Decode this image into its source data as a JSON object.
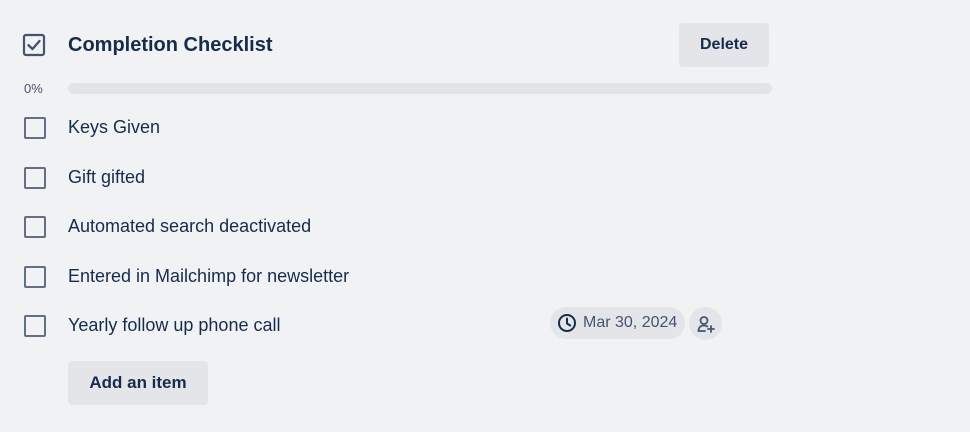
{
  "checklist": {
    "title": "Completion Checklist",
    "header_icon": "checkbox-checked-icon",
    "delete_label": "Delete",
    "progress_text": "0%",
    "progress_fraction": 0,
    "items": [
      {
        "label": "Keys Given",
        "checked": false
      },
      {
        "label": "Gift gifted",
        "checked": false
      },
      {
        "label": "Automated search deactivated",
        "checked": false
      },
      {
        "label": "Entered in Mailchimp for newsletter",
        "checked": false
      },
      {
        "label": "Yearly follow up phone call",
        "checked": false,
        "due_date": "Mar 30, 2024",
        "due_icon": "clock-icon",
        "assign_icon": "add-member-icon"
      }
    ],
    "add_item_label": "Add an item"
  },
  "colors": {
    "background": "#f1f2f4",
    "text": "#172b4d",
    "subtle_text": "#44546f",
    "button_bg": "#e3e5e9",
    "progress_track": "#e2e4e8",
    "checkbox_border": "#626f86"
  }
}
